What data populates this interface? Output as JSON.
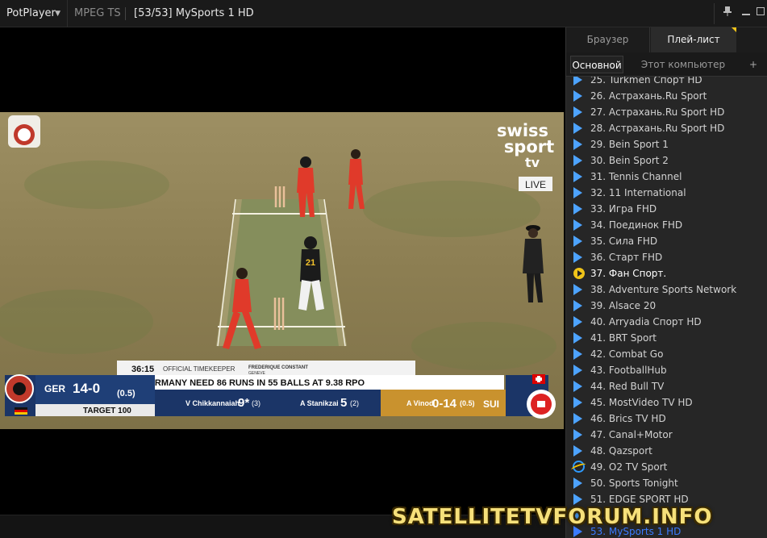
{
  "titlebar": {
    "app_name": "PotPlayer",
    "format": "MPEG TS",
    "title": "[53/53] MySports 1 HD"
  },
  "video": {
    "broadcaster": "swiss sport tv",
    "live_label": "LIVE",
    "timekeeper_time": "36:15",
    "timekeeper_label": "OFFICIAL TIMEKEEPER",
    "sponsor": "FREDERIQUE CONSTANT",
    "sponsor_sub": "GENEVE",
    "message": "GERMANY NEED 86 RUNS IN 55 BALLS AT 9.38 RPO",
    "team1": "GER",
    "score1": "14-0",
    "overs1": "(0.5)",
    "target": "TARGET 100",
    "batter1_name": "V Chikkannaiah",
    "batter1_runs": "9*",
    "batter1_balls": "(3)",
    "batter2_name": "A Stanikzai",
    "batter2_runs": "5",
    "batter2_balls": "(2)",
    "bowler_name": "A Vinod",
    "bowler_figures": "0-14",
    "bowler_overs": "(0.5)",
    "team2": "SUI",
    "player_number": "21"
  },
  "sidebar": {
    "tabs": [
      "Браузер",
      "Плей-лист"
    ],
    "subtabs": [
      "Основной",
      "Этот компьютер",
      "+"
    ],
    "items": [
      {
        "label": "25. Turkmen Спорт HD",
        "icon": "play-icon"
      },
      {
        "label": "26. Астрахань.Ru Sport",
        "icon": "play-icon"
      },
      {
        "label": "27. Астрахань.Ru Sport HD",
        "icon": "play-icon"
      },
      {
        "label": "28. Астрахань.Ru Sport HD",
        "icon": "play-icon"
      },
      {
        "label": "29. Bein Sport 1",
        "icon": "play-icon"
      },
      {
        "label": "30. Bein Sport 2",
        "icon": "play-icon"
      },
      {
        "label": "31. Tennis Channel",
        "icon": "play-icon"
      },
      {
        "label": "32. 11 International",
        "icon": "play-icon"
      },
      {
        "label": "33. Игра FHD",
        "icon": "play-icon"
      },
      {
        "label": "34. Поединок FHD",
        "icon": "play-icon"
      },
      {
        "label": "35. Сила FHD",
        "icon": "play-icon"
      },
      {
        "label": "36. Старт FHD",
        "icon": "play-icon"
      },
      {
        "label": "37. Фан Спорт.",
        "icon": "play-circle-icon"
      },
      {
        "label": "38. Adventure Sports Network",
        "icon": "play-icon"
      },
      {
        "label": "39. Alsace 20",
        "icon": "play-icon"
      },
      {
        "label": "40. Arryadia Спорт HD",
        "icon": "play-icon"
      },
      {
        "label": "41. BRT Sport",
        "icon": "play-icon"
      },
      {
        "label": "42. Combat Go",
        "icon": "play-icon"
      },
      {
        "label": "43. FootballHub",
        "icon": "play-icon"
      },
      {
        "label": "44. Red Bull TV",
        "icon": "play-icon"
      },
      {
        "label": "45. MostVideo TV HD",
        "icon": "play-icon"
      },
      {
        "label": "46. Brics TV HD",
        "icon": "play-icon"
      },
      {
        "label": "47. Canal+Motor",
        "icon": "play-icon"
      },
      {
        "label": "48. Qazsport",
        "icon": "play-icon"
      },
      {
        "label": "49. O2 TV Sport",
        "icon": "ie-icon"
      },
      {
        "label": "50. Sports Tonight",
        "icon": "play-icon"
      },
      {
        "label": "51. EDGE SPORT HD",
        "icon": "play-icon"
      },
      {
        "label": "52. ",
        "icon": "play-icon"
      },
      {
        "label": "53. MySports 1 HD",
        "icon": "play-icon"
      }
    ]
  },
  "watermark": "SATELLITETVFORUM.INFO",
  "colors": {
    "accent": "#3b7bff",
    "playlist_icon": "#4da3ff",
    "pitch": "#8a7d55",
    "home_team": "#1f3f77",
    "away_team": "#c9922e"
  }
}
